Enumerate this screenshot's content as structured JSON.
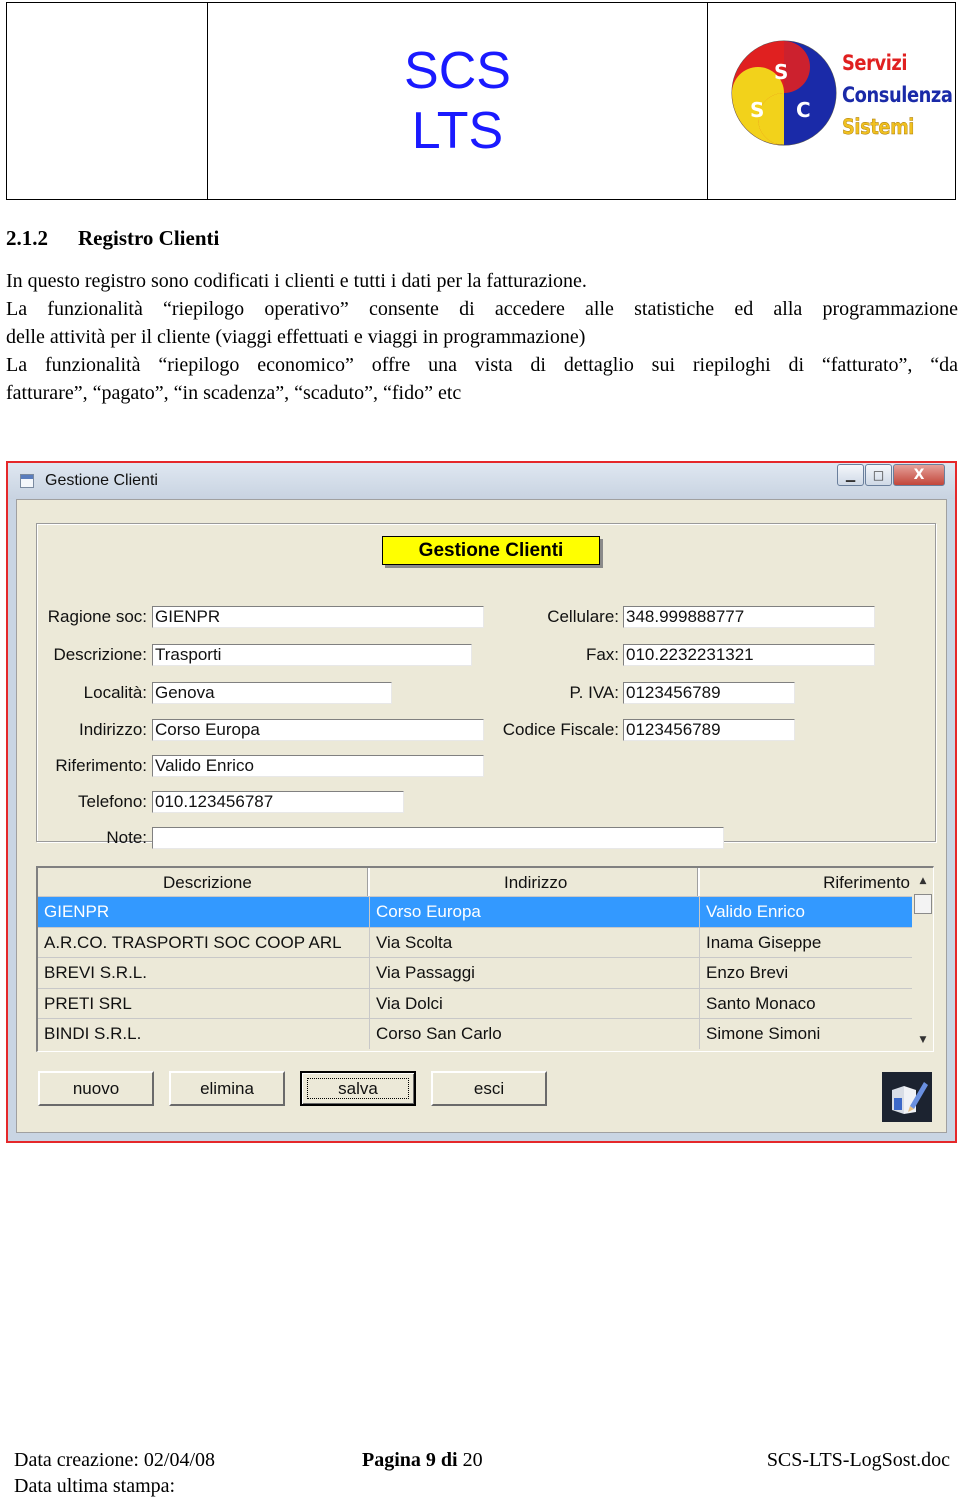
{
  "header": {
    "title_line1": "SCS",
    "title_line2": "LTS",
    "logo": {
      "letters": [
        "S",
        "S",
        "C"
      ],
      "words": [
        "Servizi",
        "Consulenza",
        "Sistemi"
      ]
    }
  },
  "section": {
    "number": "2.1.2",
    "title": "Registro Clienti"
  },
  "paragraphs": {
    "p1": "In questo registro sono codificati i clienti e tutti i dati per la fatturazione.",
    "p2_line1": "La funzionalità “riepilogo operativo” consente di accedere alle statistiche ed alla programmazione",
    "p2_line2": "delle attività per il cliente (viaggi effettuati e viaggi in programmazione)",
    "p3_line1": "La funzionalità “riepilogo economico” offre una vista di dettaglio sui riepiloghi di “fatturato”, “da",
    "p3_line2": "fatturare”, “pagato”, “in scadenza”, “scaduto”, “fido” etc"
  },
  "window": {
    "title": "Gestione Clienti",
    "controls": [
      "▁",
      "□",
      "X"
    ],
    "banner": "Gestione Clienti",
    "labels": {
      "ragione": "Ragione soc:",
      "descrizione": "Descrizione:",
      "localita": "Località:",
      "indirizzo": "Indirizzo:",
      "riferimento": "Riferimento:",
      "telefono": "Telefono:",
      "note": "Note:",
      "cellulare": "Cellulare:",
      "fax": "Fax:",
      "piva": "P. IVA:",
      "codfisc": "Codice Fiscale:"
    },
    "values": {
      "ragione": "GIENPR",
      "descrizione": "Trasporti",
      "localita": "Genova",
      "indirizzo": "Corso Europa",
      "riferimento": "Valido Enrico",
      "telefono": "010.123456787",
      "note": "",
      "cellulare": "348.999888777",
      "fax": "010.2232231321",
      "piva": "0123456789",
      "codfisc": "0123456789"
    },
    "grid": {
      "columns": [
        "Descrizione",
        "Indirizzo",
        "Riferimento"
      ],
      "rows": [
        [
          "GIENPR",
          "Corso Europa",
          "Valido Enrico"
        ],
        [
          "A.R.CO. TRASPORTI SOC COOP ARL",
          "Via Scolta",
          "Inama Giseppe"
        ],
        [
          "BREVI S.R.L.",
          "Via Passaggi",
          "Enzo Brevi"
        ],
        [
          "PRETI SRL",
          "Via Dolci",
          "Santo Monaco"
        ],
        [
          "BINDI S.R.L.",
          "Corso San Carlo",
          "Simone Simoni"
        ]
      ],
      "selected_row": 0
    },
    "buttons": {
      "nuovo": "nuovo",
      "elimina": "elimina",
      "salva": "salva",
      "esci": "esci"
    }
  },
  "footer": {
    "creazione": "Data creazione: 02/04/08",
    "stampa": "Data ultima stampa:",
    "page_label": "Pagina",
    "page_num": "9",
    "page_of": "di",
    "page_total": "20",
    "file": "SCS-LTS-LogSost.doc"
  },
  "colors": {
    "heading_blue": "#1a1aff",
    "selection": "#3399ff",
    "banner": "#ffff00",
    "window_border": "#e5282a"
  }
}
